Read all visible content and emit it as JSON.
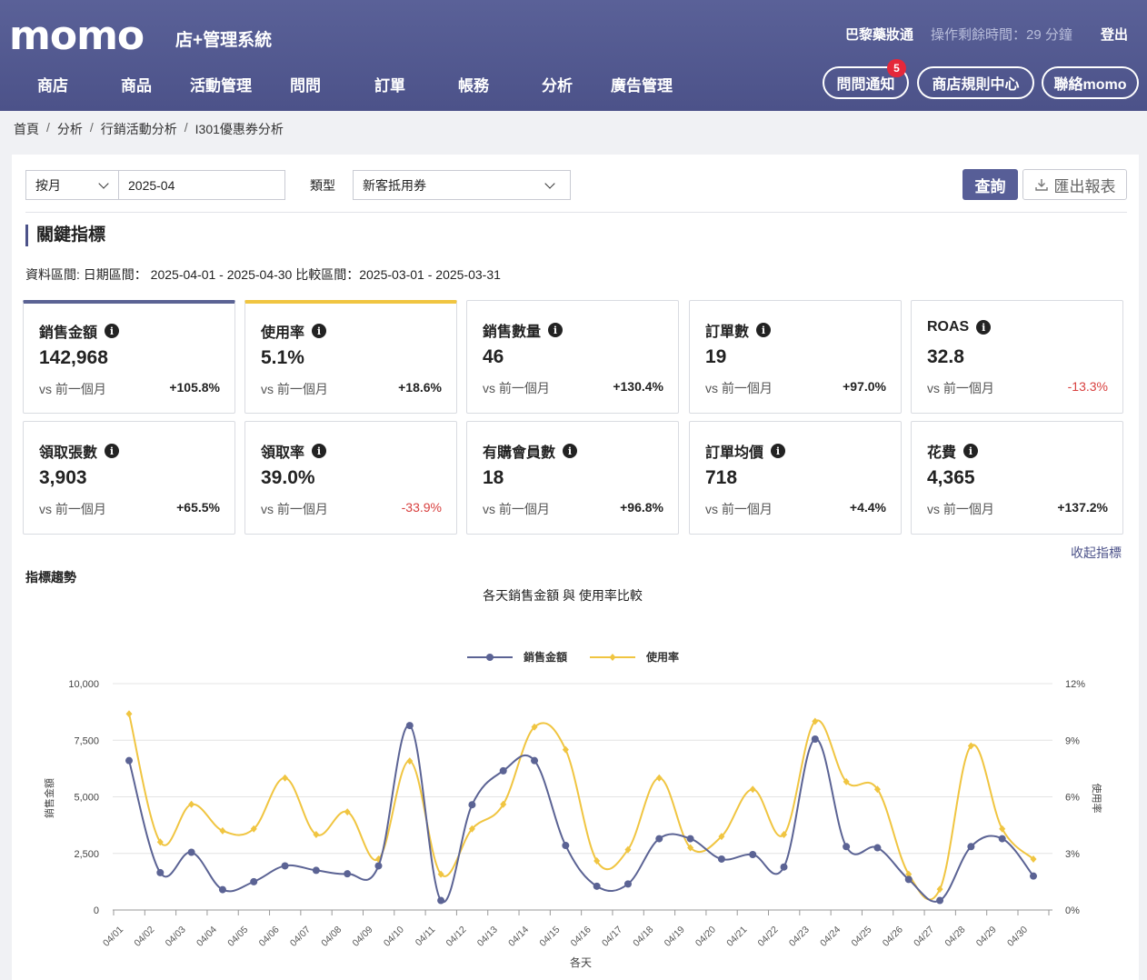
{
  "header": {
    "logo": "momo",
    "subtitle": "店+管理系統",
    "shop_name": "巴黎藥妝通",
    "timer": "操作剩餘時間：29 分鐘",
    "logout": "登出",
    "nav": [
      "商店",
      "商品",
      "活動管理",
      "問問",
      "訂單",
      "帳務",
      "分析",
      "廣告管理"
    ],
    "notify_label": "問問通知",
    "notify_count": "5",
    "rules_label": "商店規則中心",
    "contact_label": "聯絡momo"
  },
  "breadcrumb": [
    "首頁",
    "分析",
    "行銷活動分析",
    "I301優惠券分析"
  ],
  "filters": {
    "period_type": "按月",
    "period_value": "2025-04",
    "type_label": "類型",
    "type_value": "新客抵用券",
    "query_label": "查詢",
    "export_label": "匯出報表"
  },
  "kpi_section": {
    "title": "關鍵指標",
    "range": "資料區間: 日期區間：  2025-04-01 - 2025-04-30  比較區間：2025-03-01 - 2025-03-31",
    "cards": [
      {
        "title": "銷售金額",
        "value": "142,968",
        "vs": "vs 前一個月",
        "delta": "+105.8%",
        "negative": false,
        "accent": "blue"
      },
      {
        "title": "使用率",
        "value": "5.1%",
        "vs": "vs 前一個月",
        "delta": "+18.6%",
        "negative": false,
        "accent": "yellow"
      },
      {
        "title": "銷售數量",
        "value": "46",
        "vs": "vs 前一個月",
        "delta": "+130.4%",
        "negative": false,
        "accent": ""
      },
      {
        "title": "訂單數",
        "value": "19",
        "vs": "vs 前一個月",
        "delta": "+97.0%",
        "negative": false,
        "accent": ""
      },
      {
        "title": "ROAS",
        "value": "32.8",
        "vs": "vs 前一個月",
        "delta": "-13.3%",
        "negative": true,
        "accent": ""
      },
      {
        "title": "領取張數",
        "value": "3,903",
        "vs": "vs 前一個月",
        "delta": "+65.5%",
        "negative": false,
        "accent": ""
      },
      {
        "title": "領取率",
        "value": "39.0%",
        "vs": "vs 前一個月",
        "delta": "-33.9%",
        "negative": true,
        "accent": ""
      },
      {
        "title": "有購會員數",
        "value": "18",
        "vs": "vs 前一個月",
        "delta": "+96.8%",
        "negative": false,
        "accent": ""
      },
      {
        "title": "訂單均價",
        "value": "718",
        "vs": "vs 前一個月",
        "delta": "+4.4%",
        "negative": false,
        "accent": ""
      },
      {
        "title": "花費",
        "value": "4,365",
        "vs": "vs 前一個月",
        "delta": "+137.2%",
        "negative": false,
        "accent": ""
      }
    ],
    "collapse_label": "收起指標"
  },
  "trend": {
    "section_title": "指標趨勢"
  },
  "colors": {
    "header": "#4c5289",
    "sales_series": "#5b6394",
    "rate_series": "#f0c541",
    "negative": "#d8403f"
  },
  "chart_data": {
    "type": "line",
    "title": "各天銷售金額 與 使用率比較",
    "xlabel": "各天",
    "ylabel_left": "銷售金額",
    "ylabel_right": "使用率",
    "ylim_left": [
      0,
      10000
    ],
    "ylim_right": [
      0,
      12
    ],
    "yticks_left": [
      "0",
      "2,500",
      "5,000",
      "7,500",
      "10,000"
    ],
    "yticks_right": [
      "0%",
      "3%",
      "6%",
      "9%",
      "12%"
    ],
    "legend_position": "top-center",
    "grid": true,
    "categories": [
      "04/01",
      "04/02",
      "04/03",
      "04/04",
      "04/05",
      "04/06",
      "04/07",
      "04/08",
      "04/09",
      "04/10",
      "04/11",
      "04/12",
      "04/13",
      "04/14",
      "04/15",
      "04/16",
      "04/17",
      "04/18",
      "04/19",
      "04/20",
      "04/21",
      "04/22",
      "04/23",
      "04/24",
      "04/25",
      "04/26",
      "04/27",
      "04/28",
      "04/29",
      "04/30"
    ],
    "series": [
      {
        "name": "銷售金額",
        "axis": "left",
        "values": [
          6600,
          1650,
          2550,
          900,
          1250,
          1950,
          1750,
          1600,
          1950,
          8150,
          420,
          4650,
          6150,
          6600,
          2850,
          1050,
          1150,
          3150,
          3150,
          2250,
          2450,
          1900,
          7550,
          2800,
          2750,
          1350,
          420,
          2800,
          3150,
          1500
        ]
      },
      {
        "name": "使用率",
        "axis": "right",
        "values": [
          10.4,
          3.6,
          5.6,
          4.2,
          4.3,
          7.0,
          4.0,
          5.2,
          2.7,
          7.9,
          1.9,
          4.3,
          5.6,
          9.7,
          8.5,
          2.6,
          3.2,
          7.0,
          3.3,
          3.9,
          6.4,
          4.0,
          10.0,
          6.8,
          6.4,
          1.9,
          1.1,
          8.7,
          4.3,
          2.7
        ]
      }
    ]
  }
}
